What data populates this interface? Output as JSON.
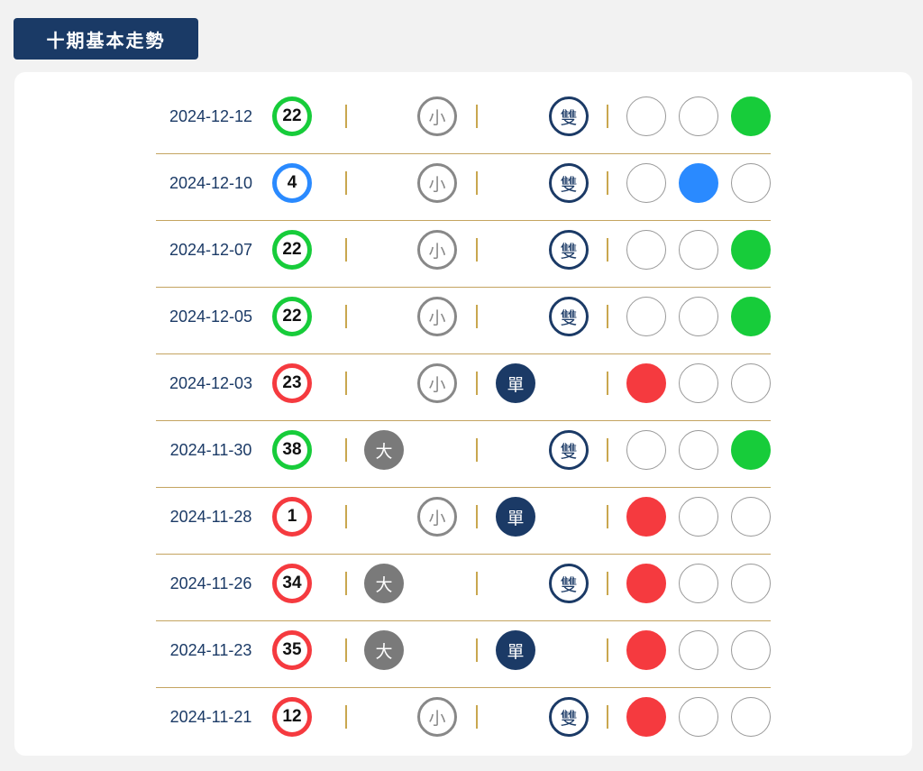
{
  "header": {
    "title": "十期基本走勢"
  },
  "labels": {
    "big": "大",
    "small": "小",
    "odd": "單",
    "even": "雙"
  },
  "colors": {
    "red": "#f53a3f",
    "blue": "#2a8aff",
    "green": "#17cc3a",
    "navy": "#1b3a66",
    "gray": "#7a7a7a",
    "gold": "#c9a74f"
  },
  "rows": [
    {
      "date": "2024-12-12",
      "number": "22",
      "color": "green",
      "size": "small",
      "parity": "even"
    },
    {
      "date": "2024-12-10",
      "number": "4",
      "color": "blue",
      "size": "small",
      "parity": "even"
    },
    {
      "date": "2024-12-07",
      "number": "22",
      "color": "green",
      "size": "small",
      "parity": "even"
    },
    {
      "date": "2024-12-05",
      "number": "22",
      "color": "green",
      "size": "small",
      "parity": "even"
    },
    {
      "date": "2024-12-03",
      "number": "23",
      "color": "red",
      "size": "small",
      "parity": "odd"
    },
    {
      "date": "2024-11-30",
      "number": "38",
      "color": "green",
      "size": "big",
      "parity": "even"
    },
    {
      "date": "2024-11-28",
      "number": "1",
      "color": "red",
      "size": "small",
      "parity": "odd"
    },
    {
      "date": "2024-11-26",
      "number": "34",
      "color": "red",
      "size": "big",
      "parity": "even"
    },
    {
      "date": "2024-11-23",
      "number": "35",
      "color": "red",
      "size": "big",
      "parity": "odd"
    },
    {
      "date": "2024-11-21",
      "number": "12",
      "color": "red",
      "size": "small",
      "parity": "even"
    }
  ]
}
